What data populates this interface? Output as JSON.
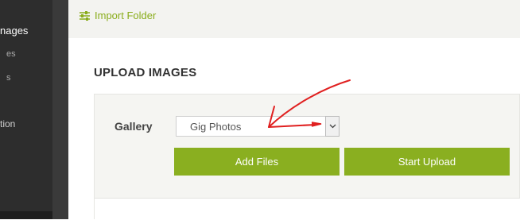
{
  "sidebar": {
    "items": [
      {
        "label": "nages"
      },
      {
        "label": "es"
      },
      {
        "label": "s"
      },
      {
        "label": "tion"
      }
    ]
  },
  "topbar": {
    "import_folder_label": "Import Folder",
    "icon": "sliders-icon"
  },
  "upload": {
    "title": "UPLOAD IMAGES",
    "gallery_label": "Gallery",
    "gallery_value": "Gig Photos",
    "add_files_label": "Add Files",
    "start_upload_label": "Start Upload"
  },
  "colors": {
    "accent": "#8aaf20",
    "annotation": "#e02020",
    "sidebar": "#2d2d2d"
  }
}
